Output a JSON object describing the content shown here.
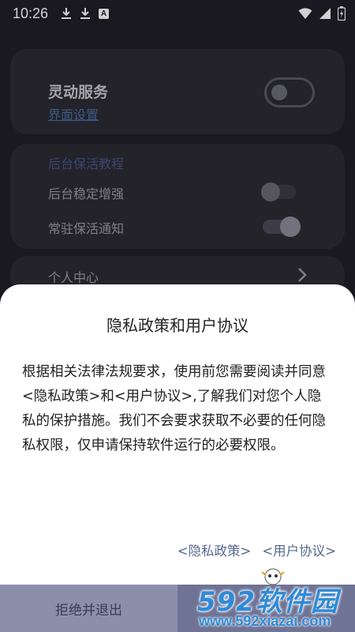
{
  "status_bar": {
    "time": "10:26",
    "a_badge": "A"
  },
  "service_card": {
    "title": "灵动服务",
    "link": "界面设置"
  },
  "keepalive_card": {
    "section_title": "后台保活教程",
    "rows": [
      {
        "label": "后台稳定增强"
      },
      {
        "label": "常驻保活通知"
      }
    ]
  },
  "personal_card": {
    "label": "个人中心"
  },
  "dialog": {
    "title": "隐私政策和用户协议",
    "body": "根据相关法律法规要求，使用前您需要阅读并同意<隐私政策>和<用户协议>,了解我们对您个人隐私的保护措施。我们不会要求获取不必要的任何隐私权限，仅申请保持软件运行的必要权限。",
    "privacy_link": "<隐私政策>",
    "agreement_link": "<用户协议>",
    "reject_button": "拒绝并退出"
  },
  "watermark": {
    "main": "592软件园",
    "url": "www.592xiazai.com"
  },
  "colors": {
    "background": "#1f1f26",
    "card": "#2b2b33",
    "sheet": "#ffffff",
    "link": "#556a8f",
    "button": "#8c8faa",
    "watermark": "#2f8ad8"
  }
}
